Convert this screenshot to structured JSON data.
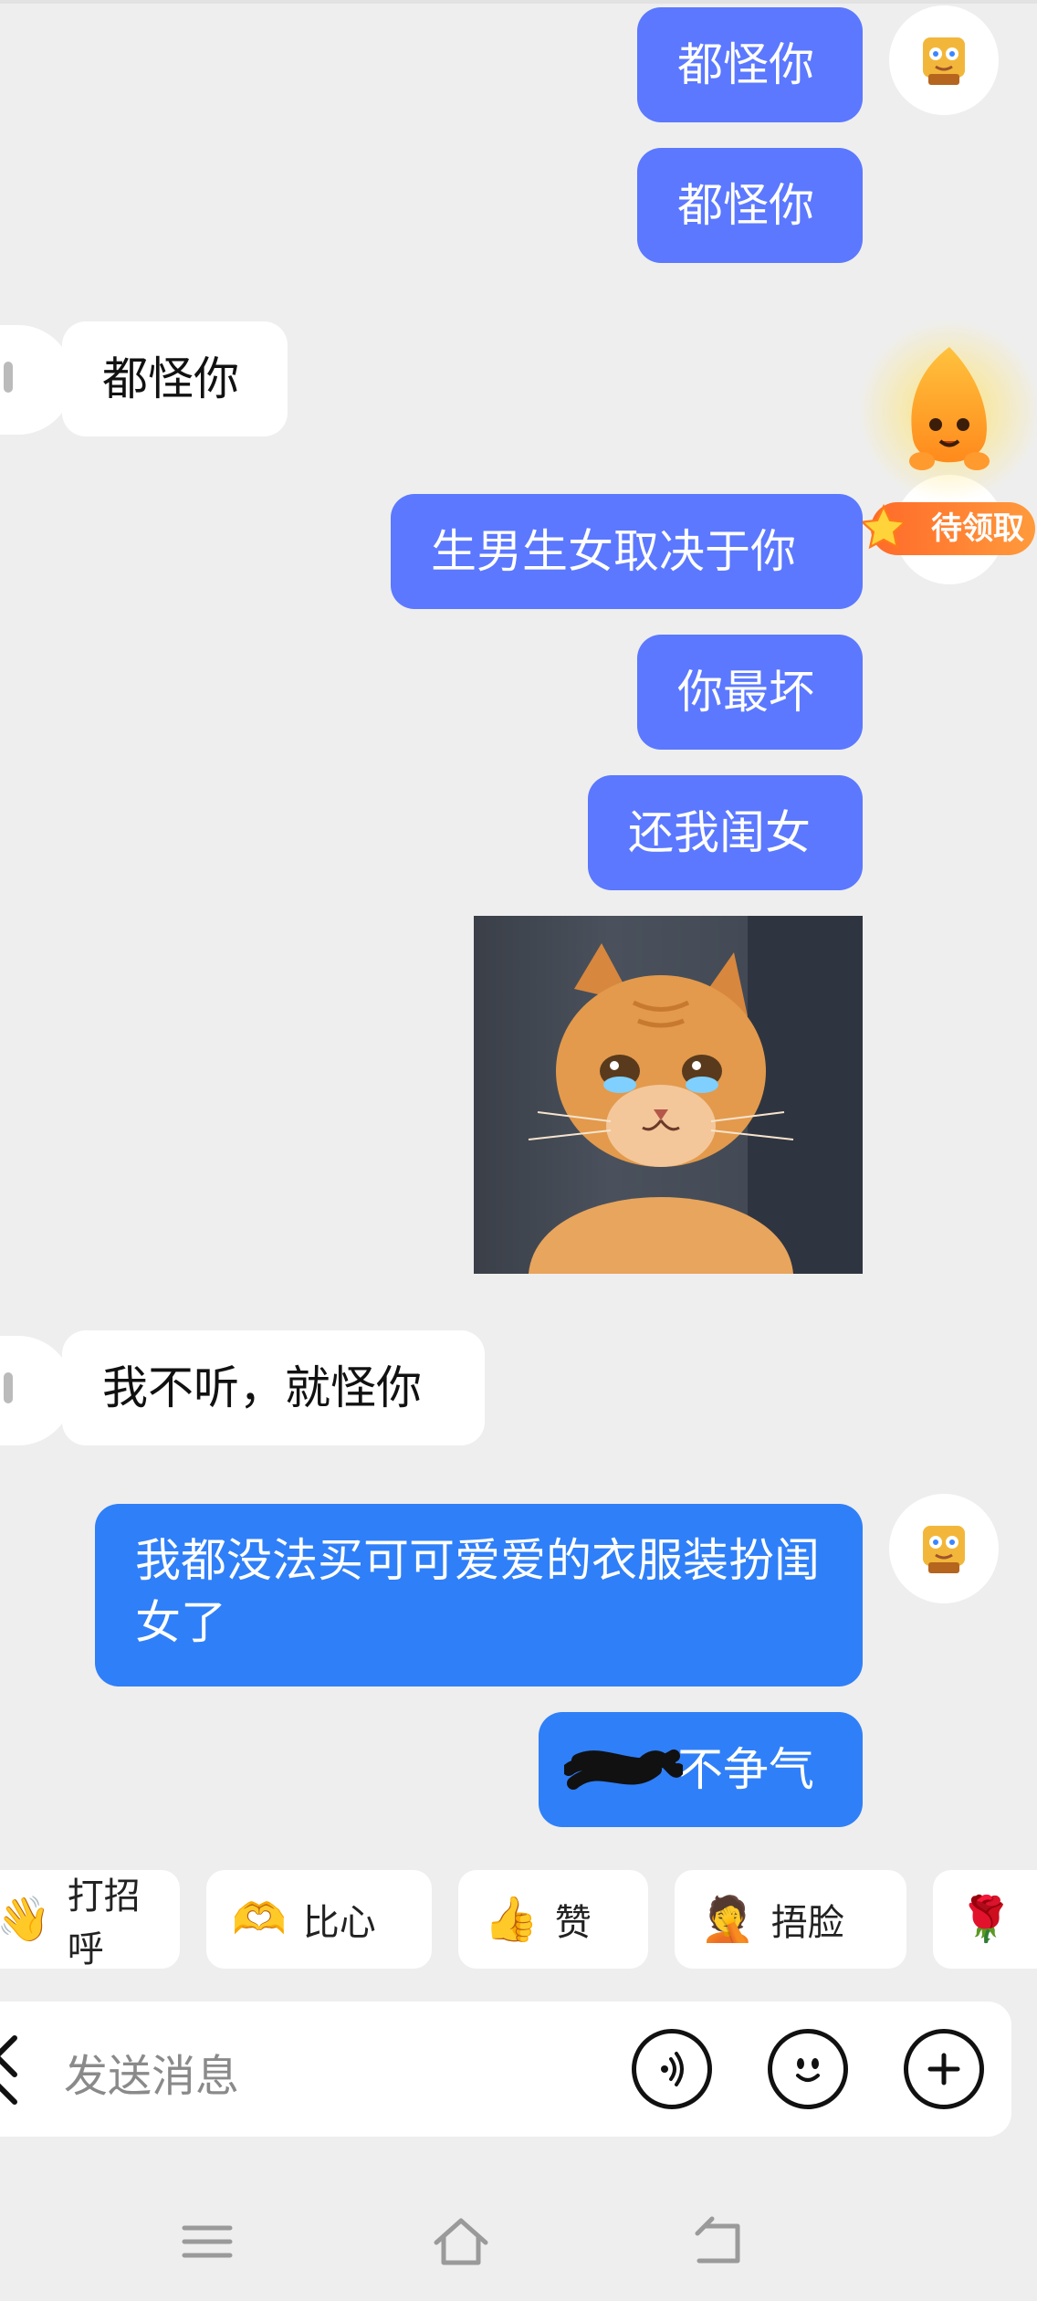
{
  "messages": [
    {
      "side": "mine",
      "text": "都怪你"
    },
    {
      "side": "mine",
      "text": "都怪你"
    },
    {
      "side": "theirs",
      "text": "都怪你"
    },
    {
      "side": "mine",
      "text": "生男生女取决于你"
    },
    {
      "side": "mine",
      "text": "你最坏"
    },
    {
      "side": "mine",
      "text": "还我闺女"
    },
    {
      "side": "mine",
      "type": "image",
      "image": "crying-cat-sticker"
    },
    {
      "side": "theirs",
      "text": "我不听，就怪你"
    },
    {
      "side": "mine",
      "text": "我都没法买可可爱爱的衣服装扮闺女了"
    },
    {
      "side": "mine",
      "text": "不争气",
      "note_hidden_prefix": "redacted"
    }
  ],
  "promo_badge": {
    "label": "待领取",
    "icon": "mascot-flame-icon"
  },
  "quick_replies": [
    {
      "emoji": "👋",
      "label": "打招呼"
    },
    {
      "emoji": "🫶",
      "label": "比心"
    },
    {
      "emoji": "👍",
      "label": "赞"
    },
    {
      "emoji": "🤦",
      "label": "捂脸"
    },
    {
      "emoji": "🌹",
      "label": ""
    }
  ],
  "composer": {
    "placeholder": "发送消息"
  },
  "icons": {
    "voice": "voice-icon",
    "emoji": "emoji-icon",
    "plus": "plus-icon"
  },
  "colors": {
    "bubble_mine": "#5b78ff",
    "bubble_mine_alt": "#2f7ff8",
    "background": "#eeeeee"
  }
}
